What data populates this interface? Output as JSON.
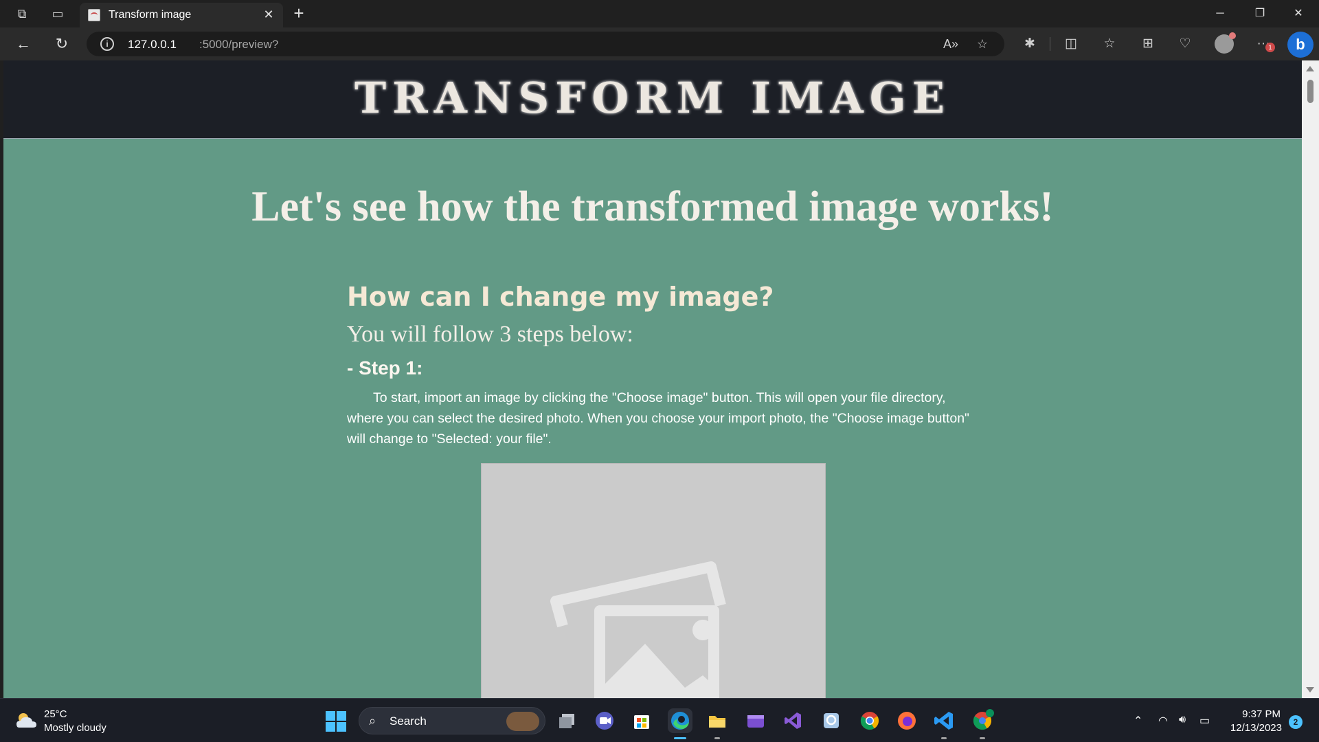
{
  "browser": {
    "tab": {
      "title": "Transform image"
    },
    "url": {
      "host": "127.0.0.1",
      "path": ":5000/preview?"
    },
    "notification_count": "1",
    "icons": {
      "workspaces": "workspaces-icon",
      "tab_actions": "tab-actions-icon",
      "back": "back-arrow-icon",
      "refresh": "refresh-icon",
      "site_info": "info-icon",
      "read_aloud": "read-aloud-icon",
      "favorite": "star-icon",
      "extensions": "puzzle-icon",
      "split_screen": "split-screen-icon",
      "favorites": "favorites-icon",
      "collections": "collections-icon",
      "browser_essentials": "heartbeat-icon",
      "settings": "more-icon",
      "copilot": "bing-icon"
    }
  },
  "page": {
    "brand": "TRANSFORM IMAGE",
    "hero": "Let's see how the transformed image works!",
    "question_title": "How can I change my image?",
    "steps_intro": "You will follow 3 steps below:",
    "step1_title": "- Step 1:",
    "step1_text": "To start, import an image by clicking the \"Choose image\" button. This will open your file directory, where you can select the desired photo. When you choose your import photo, the \"Choose image button\" will change to \"Selected: your file\"."
  },
  "taskbar": {
    "weather": {
      "temp": "25°C",
      "desc": "Mostly cloudy"
    },
    "search_label": "Search",
    "clock": {
      "time": "9:37 PM",
      "date": "12/13/2023"
    },
    "notification_count": "2"
  },
  "colors": {
    "page_bg": "#629a86",
    "header_bg": "#1c1f26",
    "accent": "#4cc2ff"
  }
}
